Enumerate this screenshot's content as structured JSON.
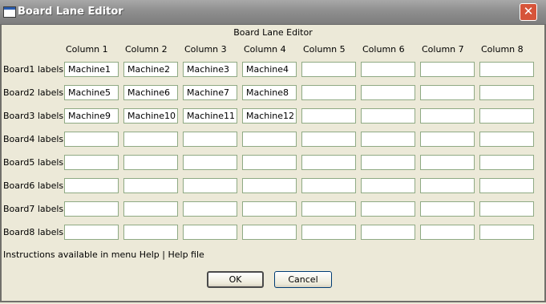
{
  "window": {
    "title": "Board Lane Editor",
    "close_glyph": "✕"
  },
  "dialog": {
    "heading": "Board Lane Editor"
  },
  "columns": [
    "Column 1",
    "Column 2",
    "Column 3",
    "Column 4",
    "Column 5",
    "Column 6",
    "Column 7",
    "Column 8"
  ],
  "rows": [
    {
      "label": "Board1 labels:",
      "values": [
        "Machine1",
        "Machine2",
        "Machine3",
        "Machine4",
        "",
        "",
        "",
        ""
      ]
    },
    {
      "label": "Board2 labels:",
      "values": [
        "Machine5",
        "Machine6",
        "Machine7",
        "Machine8",
        "",
        "",
        "",
        ""
      ]
    },
    {
      "label": "Board3 labels:",
      "values": [
        "Machine9",
        "Machine10",
        "Machine11",
        "Machine12",
        "",
        "",
        "",
        ""
      ]
    },
    {
      "label": "Board4 labels:",
      "values": [
        "",
        "",
        "",
        "",
        "",
        "",
        "",
        ""
      ]
    },
    {
      "label": "Board5 labels:",
      "values": [
        "",
        "",
        "",
        "",
        "",
        "",
        "",
        ""
      ]
    },
    {
      "label": "Board6 labels:",
      "values": [
        "",
        "",
        "",
        "",
        "",
        "",
        "",
        ""
      ]
    },
    {
      "label": "Board7 labels:",
      "values": [
        "",
        "",
        "",
        "",
        "",
        "",
        "",
        ""
      ]
    },
    {
      "label": "Board8 labels:",
      "values": [
        "",
        "",
        "",
        "",
        "",
        "",
        "",
        ""
      ]
    }
  ],
  "instructions": "Instructions available in menu Help | Help file",
  "buttons": {
    "ok": "OK",
    "cancel": "Cancel"
  }
}
